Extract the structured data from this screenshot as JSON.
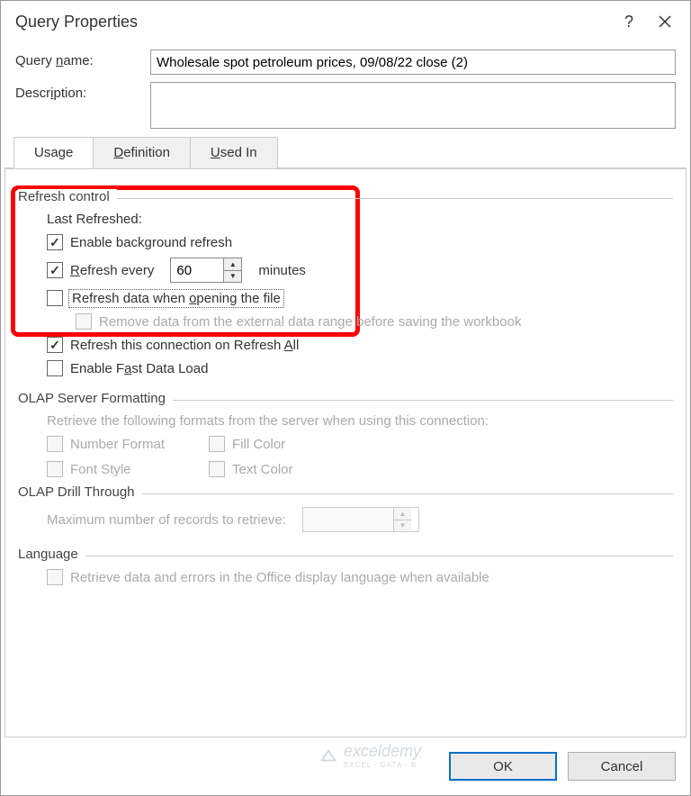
{
  "title": "Query Properties",
  "form": {
    "name_label_pre": "Query ",
    "name_label_u": "n",
    "name_label_post": "ame:",
    "name_value": "Wholesale spot petroleum prices, 09/08/22 close (2)",
    "desc_label": "Descr",
    "desc_u": "i",
    "desc_post": "ption:"
  },
  "tabs": {
    "usage": "Usage",
    "definition_u": "D",
    "definition_post": "efinition",
    "usedin_u": "U",
    "usedin_post": "sed In"
  },
  "refresh": {
    "legend": "Refresh control",
    "last": "Last Refreshed:",
    "enable_bg": "Enable background refresh",
    "refresh_every_u": "R",
    "refresh_every_post": "efresh every",
    "minutes": "minutes",
    "interval": "60",
    "on_open_pre": "Refresh data when ",
    "on_open_u": "o",
    "on_open_post": "pening the file",
    "remove_data": "Remove data from the external data range before saving the workbook",
    "refresh_all_pre": "Refresh this connection on Refresh ",
    "refresh_all_u": "A",
    "refresh_all_post": "ll",
    "fast_pre": "Enable F",
    "fast_u": "a",
    "fast_post": "st Data Load"
  },
  "olap_fmt": {
    "legend": "OLAP Server Formatting",
    "retrieve": "Retrieve the following formats from the server when using this connection:",
    "number": "Number Format",
    "fill": "Fill Color",
    "font": "Font Style",
    "text": "Text Color"
  },
  "olap_drill": {
    "legend": "OLAP Drill Through",
    "max": "Maximum number of records to retrieve:"
  },
  "lang": {
    "legend": "Language",
    "retrieve": "Retrieve data and errors in the Office display language when available"
  },
  "footer": {
    "ok": "OK",
    "cancel": "Cancel"
  },
  "watermark": {
    "brand": "exceldemy",
    "sub": "EXCEL · DATA · B"
  }
}
